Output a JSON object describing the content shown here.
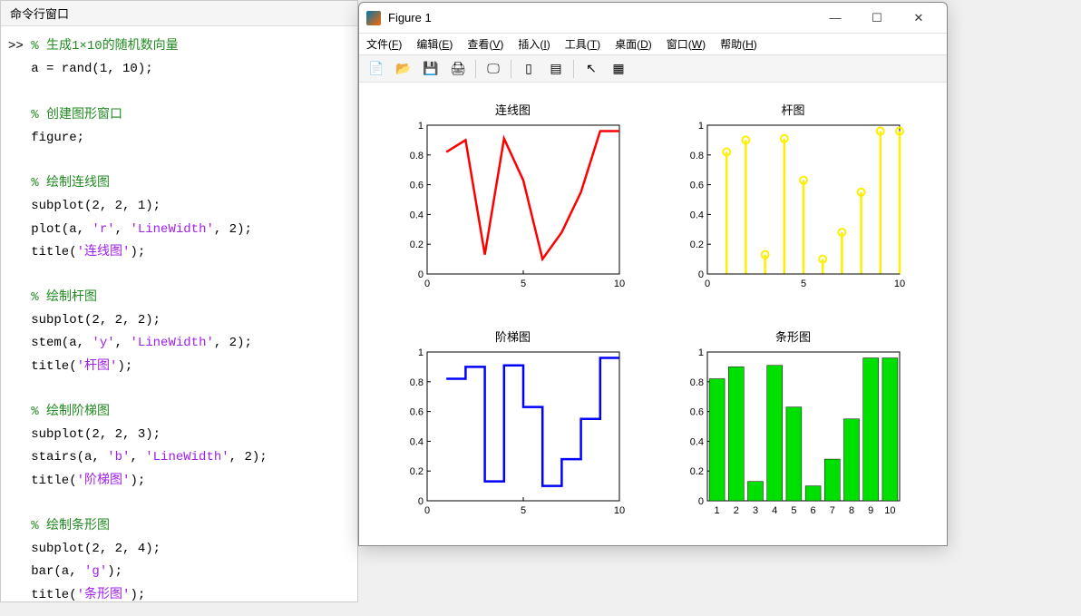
{
  "command_window": {
    "title": "命令行窗口",
    "code_lines": [
      {
        "type": "line",
        "parts": [
          {
            "cls": "prompt",
            "t": ">> "
          },
          {
            "cls": "comment",
            "t": "% 生成1×10的随机数向量"
          }
        ]
      },
      {
        "type": "line",
        "parts": [
          {
            "cls": "",
            "t": "a = rand(1, 10);"
          }
        ]
      },
      {
        "type": "blank"
      },
      {
        "type": "line",
        "parts": [
          {
            "cls": "comment",
            "t": "% 创建图形窗口"
          }
        ]
      },
      {
        "type": "line",
        "parts": [
          {
            "cls": "",
            "t": "figure;"
          }
        ]
      },
      {
        "type": "blank"
      },
      {
        "type": "line",
        "parts": [
          {
            "cls": "comment",
            "t": "% 绘制连线图"
          }
        ]
      },
      {
        "type": "line",
        "parts": [
          {
            "cls": "",
            "t": "subplot(2, 2, 1);"
          }
        ]
      },
      {
        "type": "line",
        "parts": [
          {
            "cls": "",
            "t": "plot(a, "
          },
          {
            "cls": "string",
            "t": "'r'"
          },
          {
            "cls": "",
            "t": ", "
          },
          {
            "cls": "string",
            "t": "'LineWidth'"
          },
          {
            "cls": "",
            "t": ", 2);"
          }
        ]
      },
      {
        "type": "line",
        "parts": [
          {
            "cls": "",
            "t": "title("
          },
          {
            "cls": "string",
            "t": "'连线图'"
          },
          {
            "cls": "",
            "t": ");"
          }
        ]
      },
      {
        "type": "blank"
      },
      {
        "type": "line",
        "parts": [
          {
            "cls": "comment",
            "t": "% 绘制杆图"
          }
        ]
      },
      {
        "type": "line",
        "parts": [
          {
            "cls": "",
            "t": "subplot(2, 2, 2);"
          }
        ]
      },
      {
        "type": "line",
        "parts": [
          {
            "cls": "",
            "t": "stem(a, "
          },
          {
            "cls": "string",
            "t": "'y'"
          },
          {
            "cls": "",
            "t": ", "
          },
          {
            "cls": "string",
            "t": "'LineWidth'"
          },
          {
            "cls": "",
            "t": ", 2);"
          }
        ]
      },
      {
        "type": "line",
        "parts": [
          {
            "cls": "",
            "t": "title("
          },
          {
            "cls": "string",
            "t": "'杆图'"
          },
          {
            "cls": "",
            "t": ");"
          }
        ]
      },
      {
        "type": "blank"
      },
      {
        "type": "line",
        "parts": [
          {
            "cls": "comment",
            "t": "% 绘制阶梯图"
          }
        ]
      },
      {
        "type": "line",
        "parts": [
          {
            "cls": "",
            "t": "subplot(2, 2, 3);"
          }
        ]
      },
      {
        "type": "line",
        "parts": [
          {
            "cls": "",
            "t": "stairs(a, "
          },
          {
            "cls": "string",
            "t": "'b'"
          },
          {
            "cls": "",
            "t": ", "
          },
          {
            "cls": "string",
            "t": "'LineWidth'"
          },
          {
            "cls": "",
            "t": ", 2);"
          }
        ]
      },
      {
        "type": "line",
        "parts": [
          {
            "cls": "",
            "t": "title("
          },
          {
            "cls": "string",
            "t": "'阶梯图'"
          },
          {
            "cls": "",
            "t": ");"
          }
        ]
      },
      {
        "type": "blank"
      },
      {
        "type": "line",
        "parts": [
          {
            "cls": "comment",
            "t": "% 绘制条形图"
          }
        ]
      },
      {
        "type": "line",
        "parts": [
          {
            "cls": "",
            "t": "subplot(2, 2, 4);"
          }
        ]
      },
      {
        "type": "line",
        "parts": [
          {
            "cls": "",
            "t": "bar(a, "
          },
          {
            "cls": "string",
            "t": "'g'"
          },
          {
            "cls": "",
            "t": ");"
          }
        ]
      },
      {
        "type": "line",
        "parts": [
          {
            "cls": "",
            "t": "title("
          },
          {
            "cls": "string",
            "t": "'条形图'"
          },
          {
            "cls": "",
            "t": ");"
          }
        ]
      }
    ]
  },
  "figure": {
    "title": "Figure 1",
    "menus": [
      "文件(F)",
      "编辑(E)",
      "查看(V)",
      "插入(I)",
      "工具(T)",
      "桌面(D)",
      "窗口(W)",
      "帮助(H)"
    ],
    "subplot_titles": {
      "line": "连线图",
      "stem": "杆图",
      "stairs": "阶梯图",
      "bar": "条形图"
    }
  },
  "chart_data": [
    {
      "id": "line",
      "type": "line",
      "title": "连线图",
      "x": [
        1,
        2,
        3,
        4,
        5,
        6,
        7,
        8,
        9,
        10
      ],
      "values": [
        0.82,
        0.9,
        0.13,
        0.91,
        0.63,
        0.1,
        0.28,
        0.55,
        0.96,
        0.96
      ],
      "color": "#ff0000",
      "xlim": [
        0,
        10
      ],
      "ylim": [
        0,
        1
      ],
      "yticks": [
        0,
        0.2,
        0.4,
        0.6,
        0.8,
        1
      ],
      "xticks": [
        0,
        5,
        10
      ]
    },
    {
      "id": "stem",
      "type": "stem",
      "title": "杆图",
      "x": [
        1,
        2,
        3,
        4,
        5,
        6,
        7,
        8,
        9,
        10
      ],
      "values": [
        0.82,
        0.9,
        0.13,
        0.91,
        0.63,
        0.1,
        0.28,
        0.55,
        0.96,
        0.96
      ],
      "color": "#ffee00",
      "xlim": [
        0,
        10
      ],
      "ylim": [
        0,
        1
      ],
      "yticks": [
        0,
        0.2,
        0.4,
        0.6,
        0.8,
        1
      ],
      "xticks": [
        0,
        5,
        10
      ]
    },
    {
      "id": "stairs",
      "type": "stairs",
      "title": "阶梯图",
      "x": [
        1,
        2,
        3,
        4,
        5,
        6,
        7,
        8,
        9,
        10
      ],
      "values": [
        0.82,
        0.9,
        0.13,
        0.91,
        0.63,
        0.1,
        0.28,
        0.55,
        0.96,
        0.96
      ],
      "color": "#0000ff",
      "xlim": [
        0,
        10
      ],
      "ylim": [
        0,
        1
      ],
      "yticks": [
        0,
        0.2,
        0.4,
        0.6,
        0.8,
        1
      ],
      "xticks": [
        0,
        5,
        10
      ]
    },
    {
      "id": "bar",
      "type": "bar",
      "title": "条形图",
      "categories": [
        1,
        2,
        3,
        4,
        5,
        6,
        7,
        8,
        9,
        10
      ],
      "values": [
        0.82,
        0.9,
        0.13,
        0.91,
        0.63,
        0.1,
        0.28,
        0.55,
        0.96,
        0.96
      ],
      "color": "#00e000",
      "xlim": [
        0.5,
        10.5
      ],
      "ylim": [
        0,
        1
      ],
      "yticks": [
        0,
        0.2,
        0.4,
        0.6,
        0.8,
        1
      ],
      "xticks": [
        1,
        2,
        3,
        4,
        5,
        6,
        7,
        8,
        9,
        10
      ]
    }
  ]
}
